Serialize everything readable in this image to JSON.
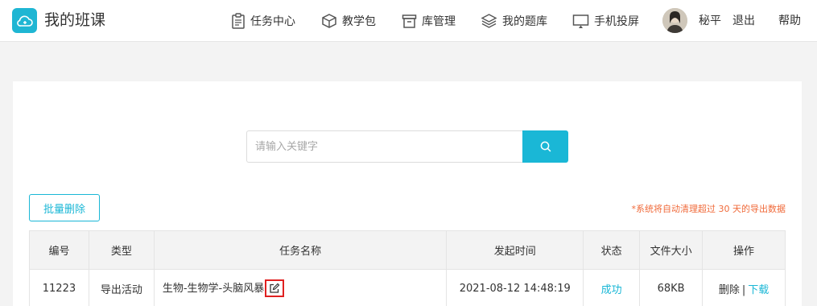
{
  "header": {
    "app_title": "我的班课",
    "nav": [
      {
        "label": "任务中心",
        "icon": "clipboard-icon"
      },
      {
        "label": "教学包",
        "icon": "package-icon"
      },
      {
        "label": "库管理",
        "icon": "archive-icon"
      },
      {
        "label": "我的题库",
        "icon": "layers-icon"
      },
      {
        "label": "手机投屏",
        "icon": "screen-cast-icon"
      }
    ],
    "user_name": "秘平",
    "logout_label": "退出",
    "help_label": "帮助"
  },
  "search": {
    "placeholder": "请输入关键字"
  },
  "toolbar": {
    "batch_delete_label": "批量删除",
    "notice": "*系统将自动清理超过 30 天的导出数据"
  },
  "table": {
    "columns": [
      "编号",
      "类型",
      "任务名称",
      "发起时间",
      "状态",
      "文件大小",
      "操作"
    ],
    "rows": [
      {
        "id": "11223",
        "type": "导出活动",
        "task_name": "生物-生物学-头脑风暴",
        "start_time": "2021-08-12 14:48:19",
        "status": "成功",
        "file_size": "68KB",
        "delete_label": "删除",
        "separator": "|",
        "download_label": "下载"
      }
    ]
  },
  "colors": {
    "accent": "#1ab7d6",
    "notice": "#f06a3a",
    "highlight_box": "#e02020"
  }
}
